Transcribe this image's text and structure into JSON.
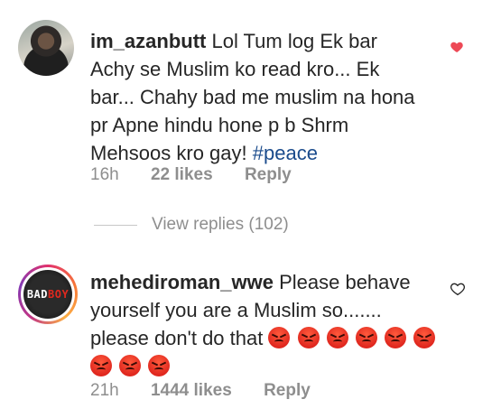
{
  "comments": [
    {
      "username": "im_azanbutt",
      "text": "Lol Tum log Ek bar Achy se Muslim ko read kro... Ek bar... Chahy bad me muslim na hona pr Apne hindu hone p b Shrm Mehsoos kro gay!",
      "hashtag": "#peace",
      "time": "16h",
      "likes": "22 likes",
      "reply": "Reply",
      "liked": true
    },
    {
      "username": "mehediroman_wwe",
      "text": "Please behave yourself you are a Muslim so....... please don't do that",
      "avatar_text_white": "BAD",
      "avatar_text_red": "BOY",
      "emoji_count": 9,
      "time": "21h",
      "likes": "1444 likes",
      "reply": "Reply",
      "liked": false
    }
  ],
  "view_replies": "View replies (102)",
  "colors": {
    "heart": "#ed4956",
    "hashtag": "#1a4b8c",
    "meta": "#8e8e8e"
  }
}
